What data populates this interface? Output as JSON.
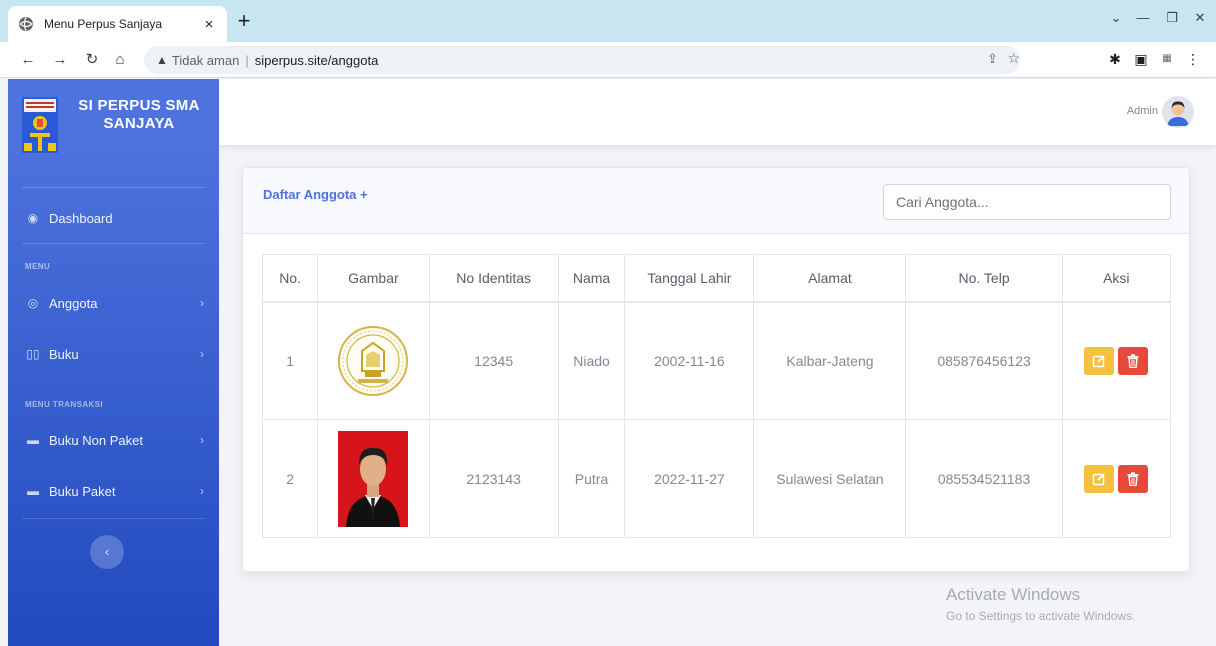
{
  "browser": {
    "tab_title": "Menu Perpus Sanjaya",
    "tab_close": "×",
    "new_tab": "+",
    "security_label": "Tidak aman",
    "url": "siperpus.site/anggota"
  },
  "sidebar": {
    "brand": "SI PERPUS SMA SANJAYA",
    "items": [
      {
        "label": "Dashboard",
        "icon": "tachometer-icon"
      },
      {
        "label": "Anggota",
        "icon": "user-circle-icon"
      },
      {
        "label": "Buku",
        "icon": "book-open-icon"
      },
      {
        "label": "Buku Non Paket",
        "icon": "folder-icon"
      },
      {
        "label": "Buku Paket",
        "icon": "folder-icon"
      }
    ],
    "heading_menu": "MENU",
    "heading_transaksi": "MENU TRANSAKSI",
    "toggle_icon": "chevron-left-icon"
  },
  "topbar": {
    "user_name": "Admin"
  },
  "main": {
    "card_title": "Daftar Anggota +",
    "search_placeholder": "Cari Anggota...",
    "columns": [
      "No.",
      "Gambar",
      "No Identitas",
      "Nama",
      "Tanggal Lahir",
      "Alamat",
      "No. Telp",
      "Aksi"
    ],
    "rows": [
      {
        "no": "1",
        "image": "school-emblem",
        "id": "12345",
        "name": "Niado",
        "dob": "2002-11-16",
        "address": "Kalbar-Jateng",
        "phone": "085876456123"
      },
      {
        "no": "2",
        "image": "portrait-photo",
        "id": "2123143",
        "name": "Putra",
        "dob": "2022-11-27",
        "address": "Sulawesi Selatan",
        "phone": "085534521183"
      }
    ]
  },
  "watermark": {
    "title": "Activate Windows",
    "subtitle": "Go to Settings to activate Windows."
  },
  "colors": {
    "primary": "#4e73df",
    "warning": "#f6c23e",
    "danger": "#e74a3b",
    "tabbar": "#c8e6f1"
  }
}
